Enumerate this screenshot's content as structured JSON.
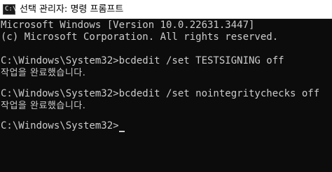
{
  "window": {
    "title": "선택 관리자: 명령 프롬프트",
    "icon_label": "C:\\"
  },
  "console": {
    "lines": [
      "Microsoft Windows [Version 10.0.22631.3447]",
      "(c) Microsoft Corporation. All rights reserved.",
      "",
      "C:\\Windows\\System32>bcdedit /set TESTSIGNING off",
      "작업을 완료했습니다.",
      "",
      "C:\\Windows\\System32>bcdedit /set nointegritychecks off",
      "작업을 완료했습니다.",
      "",
      "C:\\Windows\\System32>"
    ]
  },
  "colors": {
    "background": "#0c0c0c",
    "text": "#cccccc",
    "titlebar": "#ffffff"
  }
}
